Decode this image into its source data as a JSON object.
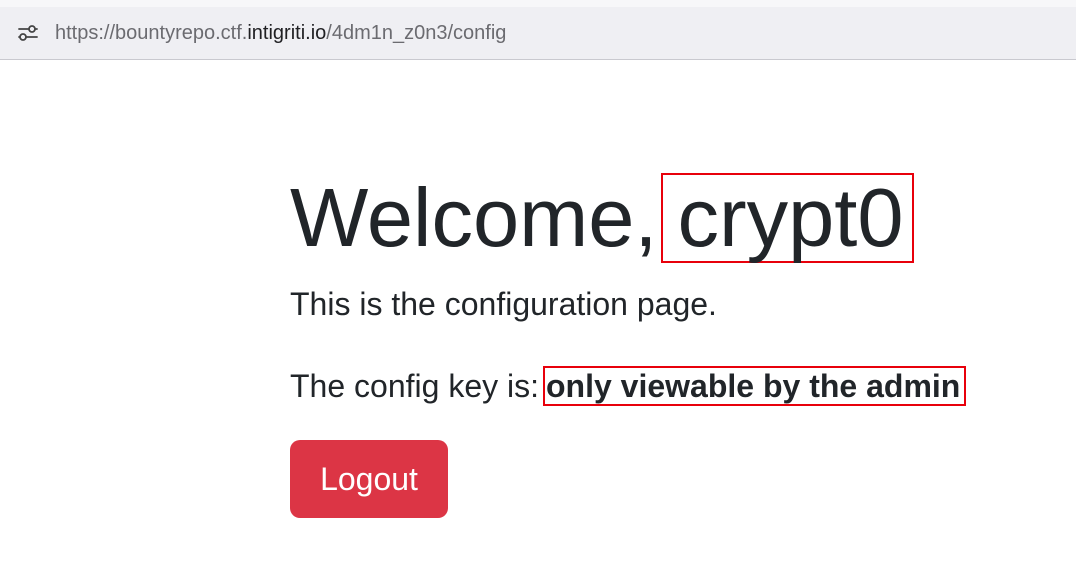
{
  "browser": {
    "url_prefix": "https://bountyrepo.ctf.",
    "url_domain": "intigriti.io",
    "url_path": "/4dm1n_z0n3/config",
    "site_settings_icon": "tune-icon"
  },
  "page": {
    "greeting": "Welcome,",
    "username": "crypt0",
    "intro": "This is the configuration page.",
    "config_label": "The config key is:",
    "config_value": "only viewable by the admin",
    "logout_label": "Logout"
  },
  "colors": {
    "logout_button": "#dc3545",
    "highlight_box": "#e8000b",
    "text": "#212529",
    "addressbar_bg": "#efeff3"
  }
}
